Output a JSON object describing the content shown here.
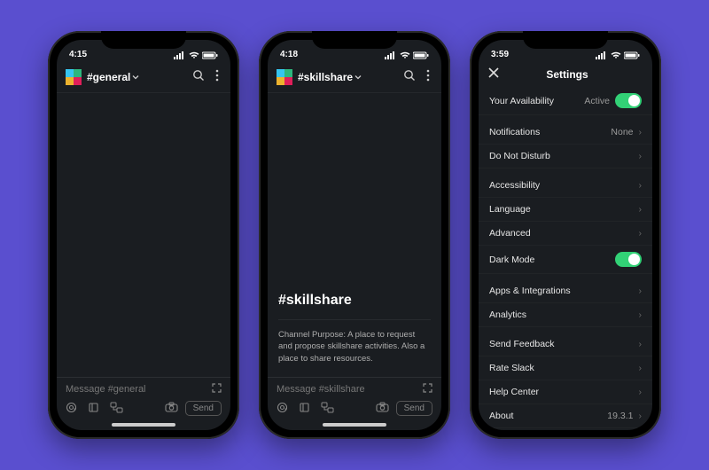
{
  "phones": [
    {
      "time": "4:15",
      "channel": "#general",
      "channel_heading": "",
      "channel_purpose": "",
      "composer_placeholder": "Message #general",
      "send_label": "Send"
    },
    {
      "time": "4:18",
      "channel": "#skillshare",
      "channel_heading": "#skillshare",
      "channel_purpose": "Channel Purpose: A place to request and propose skillshare activities. Also a place to share resources.",
      "composer_placeholder": "Message #skillshare",
      "send_label": "Send"
    },
    {
      "time": "3:59",
      "settings_title": "Settings",
      "rows": {
        "availability_label": "Your Availability",
        "availability_value": "Active",
        "notifications_label": "Notifications",
        "notifications_value": "None",
        "dnd_label": "Do Not Disturb",
        "accessibility_label": "Accessibility",
        "language_label": "Language",
        "advanced_label": "Advanced",
        "darkmode_label": "Dark Mode",
        "apps_label": "Apps & Integrations",
        "analytics_label": "Analytics",
        "feedback_label": "Send Feedback",
        "rate_label": "Rate Slack",
        "help_label": "Help Center",
        "about_label": "About",
        "about_value": "19.3.1"
      }
    }
  ]
}
